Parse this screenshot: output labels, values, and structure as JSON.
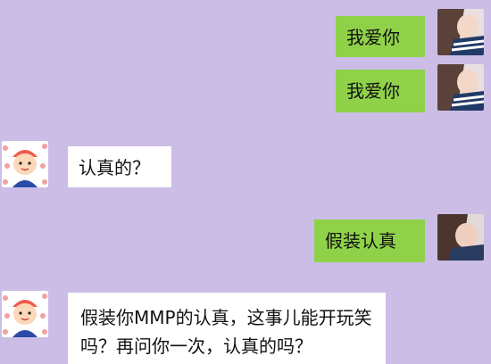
{
  "messages": [
    {
      "side": "mine",
      "text": "我爱你",
      "avatar": "girl-avatar"
    },
    {
      "side": "mine",
      "text": "我爱你",
      "avatar": "girl-avatar"
    },
    {
      "side": "theirs",
      "text": "认真的？",
      "avatar": "cartoon-boy-avatar"
    },
    {
      "side": "mine",
      "text": "假装认真",
      "avatar": "girl-avatar"
    },
    {
      "side": "theirs",
      "text": "假装你MMP的认真，这事儿能开玩笑吗？再问你一次，认真的吗？",
      "avatar": "cartoon-boy-avatar"
    }
  ],
  "colors": {
    "background": "#cbbde6",
    "mine_bubble": "#8fd24a",
    "theirs_bubble": "#ffffff"
  }
}
